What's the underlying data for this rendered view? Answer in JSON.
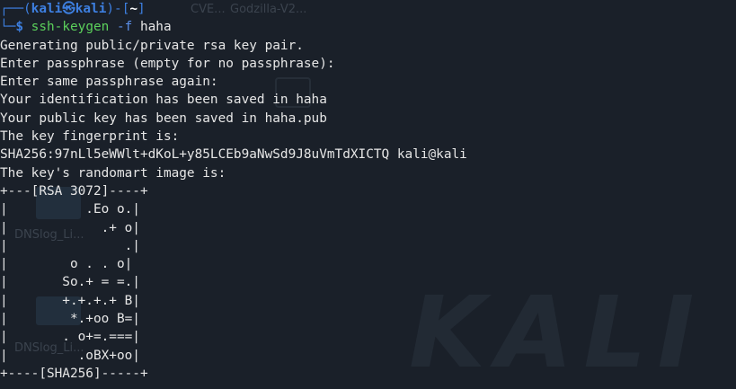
{
  "background": {
    "tab_1": "CVE...",
    "tab_2": "Godzilla-V2...",
    "icon_1_label": "DNSlog_Li...",
    "icon_2_label": "DNSlog_Li...",
    "logo_text": "KALI"
  },
  "prompt": {
    "top_prefix": "┌──(",
    "user": "kali",
    "at_symbol": "㉿",
    "host": "kali",
    "top_mid": ")-[",
    "path": "~",
    "top_suffix": "]",
    "bottom_prefix": "└─",
    "dollar": "$",
    "command": "ssh-keygen",
    "flag": "-f",
    "argument": "haha"
  },
  "output_lines": [
    "Generating public/private rsa key pair.",
    "Enter passphrase (empty for no passphrase):",
    "Enter same passphrase again:",
    "Your identification has been saved in haha",
    "Your public key has been saved in haha.pub",
    "The key fingerprint is:",
    "SHA256:97nLl5eWWlt+dKoL+y85LCEb9aNwSd9J8uVmTdXICTQ kali@kali",
    "The key's randomart image is:",
    "+---[RSA 3072]----+",
    "|          .Eo o.|",
    "|            .+ o|",
    "|               .|",
    "|        o . . o|",
    "|       So.+ = =.|",
    "|       +.+.+.+ B|",
    "|        *.+oo B=|",
    "|       . o+=.===|",
    "|         .oBX+oo|",
    "+----[SHA256]-----+"
  ],
  "colors": {
    "terminal_bg": "#1a2029",
    "prompt_blue": "#3d7fe0",
    "command_green": "#5bd05b",
    "text": "#e6e6e6"
  }
}
